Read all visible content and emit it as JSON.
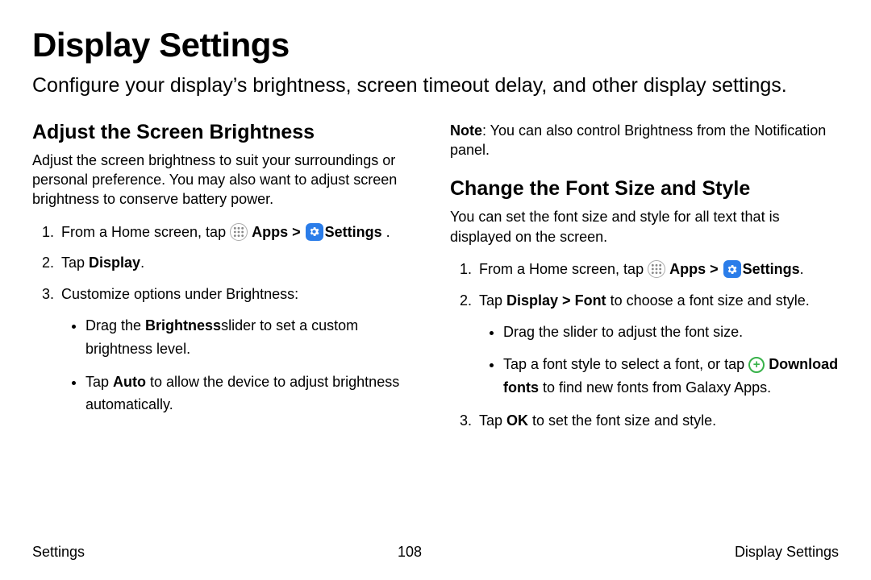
{
  "page": {
    "title": "Display Settings",
    "intro": "Configure your display’s brightness, screen timeout delay, and other display settings."
  },
  "left": {
    "heading": "Adjust the Screen Brightness",
    "desc": "Adjust the screen brightness to suit your surroundings or personal preference. You may also want to adjust screen brightness to conserve battery power.",
    "step1_prefix": "From a Home screen, tap ",
    "apps_label": "Apps",
    "chevron": " > ",
    "settings_label": "Settings",
    "step1_suffix": " .",
    "step2_prefix": "Tap ",
    "step2_bold": "Display",
    "step2_suffix": ".",
    "step3": "Customize options under Brightness:",
    "bullet1_pre": "Drag the ",
    "bullet1_bold": "Brightness",
    "bullet1_post": "slider  to set a custom brightness level.",
    "bullet2_pre": "Tap ",
    "bullet2_bold": "Auto",
    "bullet2_post": " to allow the device to adjust brightness automatically."
  },
  "right": {
    "note_bold": "Note",
    "note_text": ": You can also control Brightness from the Notification panel.",
    "heading": "Change the Font Size and Style",
    "desc": "You can set the font size and style for all text that is displayed on the screen.",
    "step1_prefix": "From a Home screen, tap ",
    "apps_label": "Apps",
    "chevron": " > ",
    "settings_label": "Settings",
    "step1_suffix": ".",
    "step2_pre": "Tap ",
    "step2_bold": "Display > Font",
    "step2_post": " to choose a font size and style.",
    "bullet1": "Drag the slider to adjust the font size.",
    "bullet2_pre": "Tap a font style to select a font, or tap ",
    "bullet2_bold": "Download fonts",
    "bullet2_post": " to find new fonts from Galaxy Apps.",
    "step3_pre": "Tap ",
    "step3_bold": "OK",
    "step3_post": " to set the font size and style."
  },
  "footer": {
    "left": "Settings",
    "center": "108",
    "right": "Display Settings"
  }
}
